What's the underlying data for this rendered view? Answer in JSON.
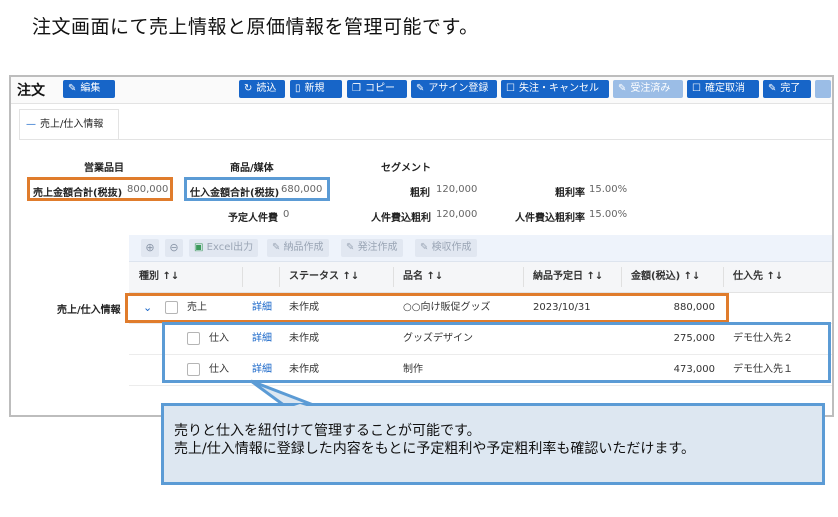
{
  "heading": "注文画面にて売上情報と原価情報を管理可能です。",
  "toolbar": {
    "title": "注文",
    "edit_label": "編集",
    "buttons": [
      {
        "label": "読込",
        "icon": "refresh-icon"
      },
      {
        "label": "新規",
        "icon": "file-icon"
      },
      {
        "label": "コピー",
        "icon": "copy-icon"
      },
      {
        "label": "アサイン登録",
        "icon": "pencil-icon"
      },
      {
        "label": "失注・キャンセル",
        "icon": "square-icon"
      },
      {
        "label": "受注済み",
        "icon": "pencil-icon",
        "disabled": true
      },
      {
        "label": "確定取消",
        "icon": "square-icon"
      },
      {
        "label": "完了",
        "icon": "pencil-icon"
      }
    ]
  },
  "section_tab": {
    "label": "売上/仕入情報"
  },
  "info": {
    "sales_item_label": "営業品目",
    "product_label": "商品/媒体",
    "segment_label": "セグメント",
    "sales_total_label": "売上金額合計(税抜)",
    "sales_total_value": "800,000",
    "purchase_total_label": "仕入金額合計(税抜)",
    "purchase_total_value": "680,000",
    "gross_profit_label": "粗利",
    "gross_profit_value": "120,000",
    "gross_margin_label": "粗利率",
    "gross_margin_value": "15.00%",
    "planned_labor_label": "予定人件費",
    "planned_labor_value": "0",
    "labor_gross_label": "人件費込粗利",
    "labor_gross_value": "120,000",
    "labor_margin_label": "人件費込粗利率",
    "labor_margin_value": "15.00%"
  },
  "grid": {
    "row_label": "売上/仕入情報",
    "tools": [
      {
        "label": "Excel出力",
        "icon": "excel-icon"
      },
      {
        "label": "納品作成",
        "icon": "pencil-icon"
      },
      {
        "label": "発注作成",
        "icon": "pencil-icon"
      },
      {
        "label": "検収作成",
        "icon": "pencil-icon"
      }
    ],
    "columns": [
      "種別 ↑↓",
      "ステータス ↑↓",
      "品名 ↑↓",
      "納品予定日 ↑↓",
      "金額(税込) ↑↓",
      "仕入先 ↑↓"
    ],
    "rows": [
      {
        "type": "売上",
        "detail": "詳細",
        "status": "未作成",
        "name": "○○向け販促グッズ",
        "date": "2023/10/31",
        "amount": "880,000",
        "vendor": ""
      },
      {
        "type": "仕入",
        "detail": "詳細",
        "status": "未作成",
        "name": "グッズデザイン",
        "date": "",
        "amount": "275,000",
        "vendor": "デモ仕入先２"
      },
      {
        "type": "仕入",
        "detail": "詳細",
        "status": "未作成",
        "name": "制作",
        "date": "",
        "amount": "473,000",
        "vendor": "デモ仕入先１"
      }
    ]
  },
  "callout": {
    "line1": "売りと仕入を紐付けて管理することが可能です。",
    "line2": "売上/仕入情報に登録した内容をもとに予定粗利や予定粗利率も確認いただけます。"
  },
  "colors": {
    "primary": "#1765c8",
    "orange": "#e07c2c",
    "blue": "#5b9bd5"
  }
}
